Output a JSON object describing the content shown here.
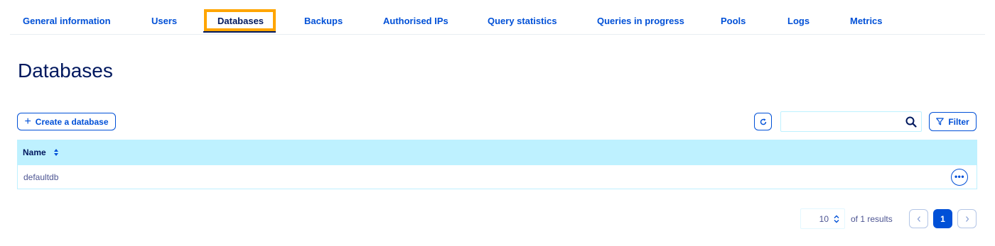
{
  "tabs": [
    {
      "label": "General information"
    },
    {
      "label": "Users"
    },
    {
      "label": "Databases",
      "active": true
    },
    {
      "label": "Backups"
    },
    {
      "label": "Authorised IPs"
    },
    {
      "label": "Query statistics"
    },
    {
      "label": "Queries in progress"
    },
    {
      "label": "Pools"
    },
    {
      "label": "Logs"
    },
    {
      "label": "Metrics"
    }
  ],
  "page": {
    "title": "Databases"
  },
  "toolbar": {
    "create_label": "Create a database",
    "create_icon": "plus-icon",
    "refresh_icon": "refresh-icon",
    "search_value": "",
    "search_icon": "search-icon",
    "filter_label": "Filter",
    "filter_icon": "filter-icon"
  },
  "table": {
    "columns": [
      {
        "label": "Name",
        "sortable": true
      }
    ],
    "rows": [
      {
        "name": "defaultdb",
        "actions_icon": "more-icon"
      }
    ]
  },
  "pagination": {
    "page_size": "10",
    "results_text": "of 1 results",
    "current_page": "1"
  },
  "colors": {
    "primary": "#0050d7",
    "dark": "#00185e",
    "header_bg": "#bef1ff",
    "highlight": "#ffa500"
  }
}
